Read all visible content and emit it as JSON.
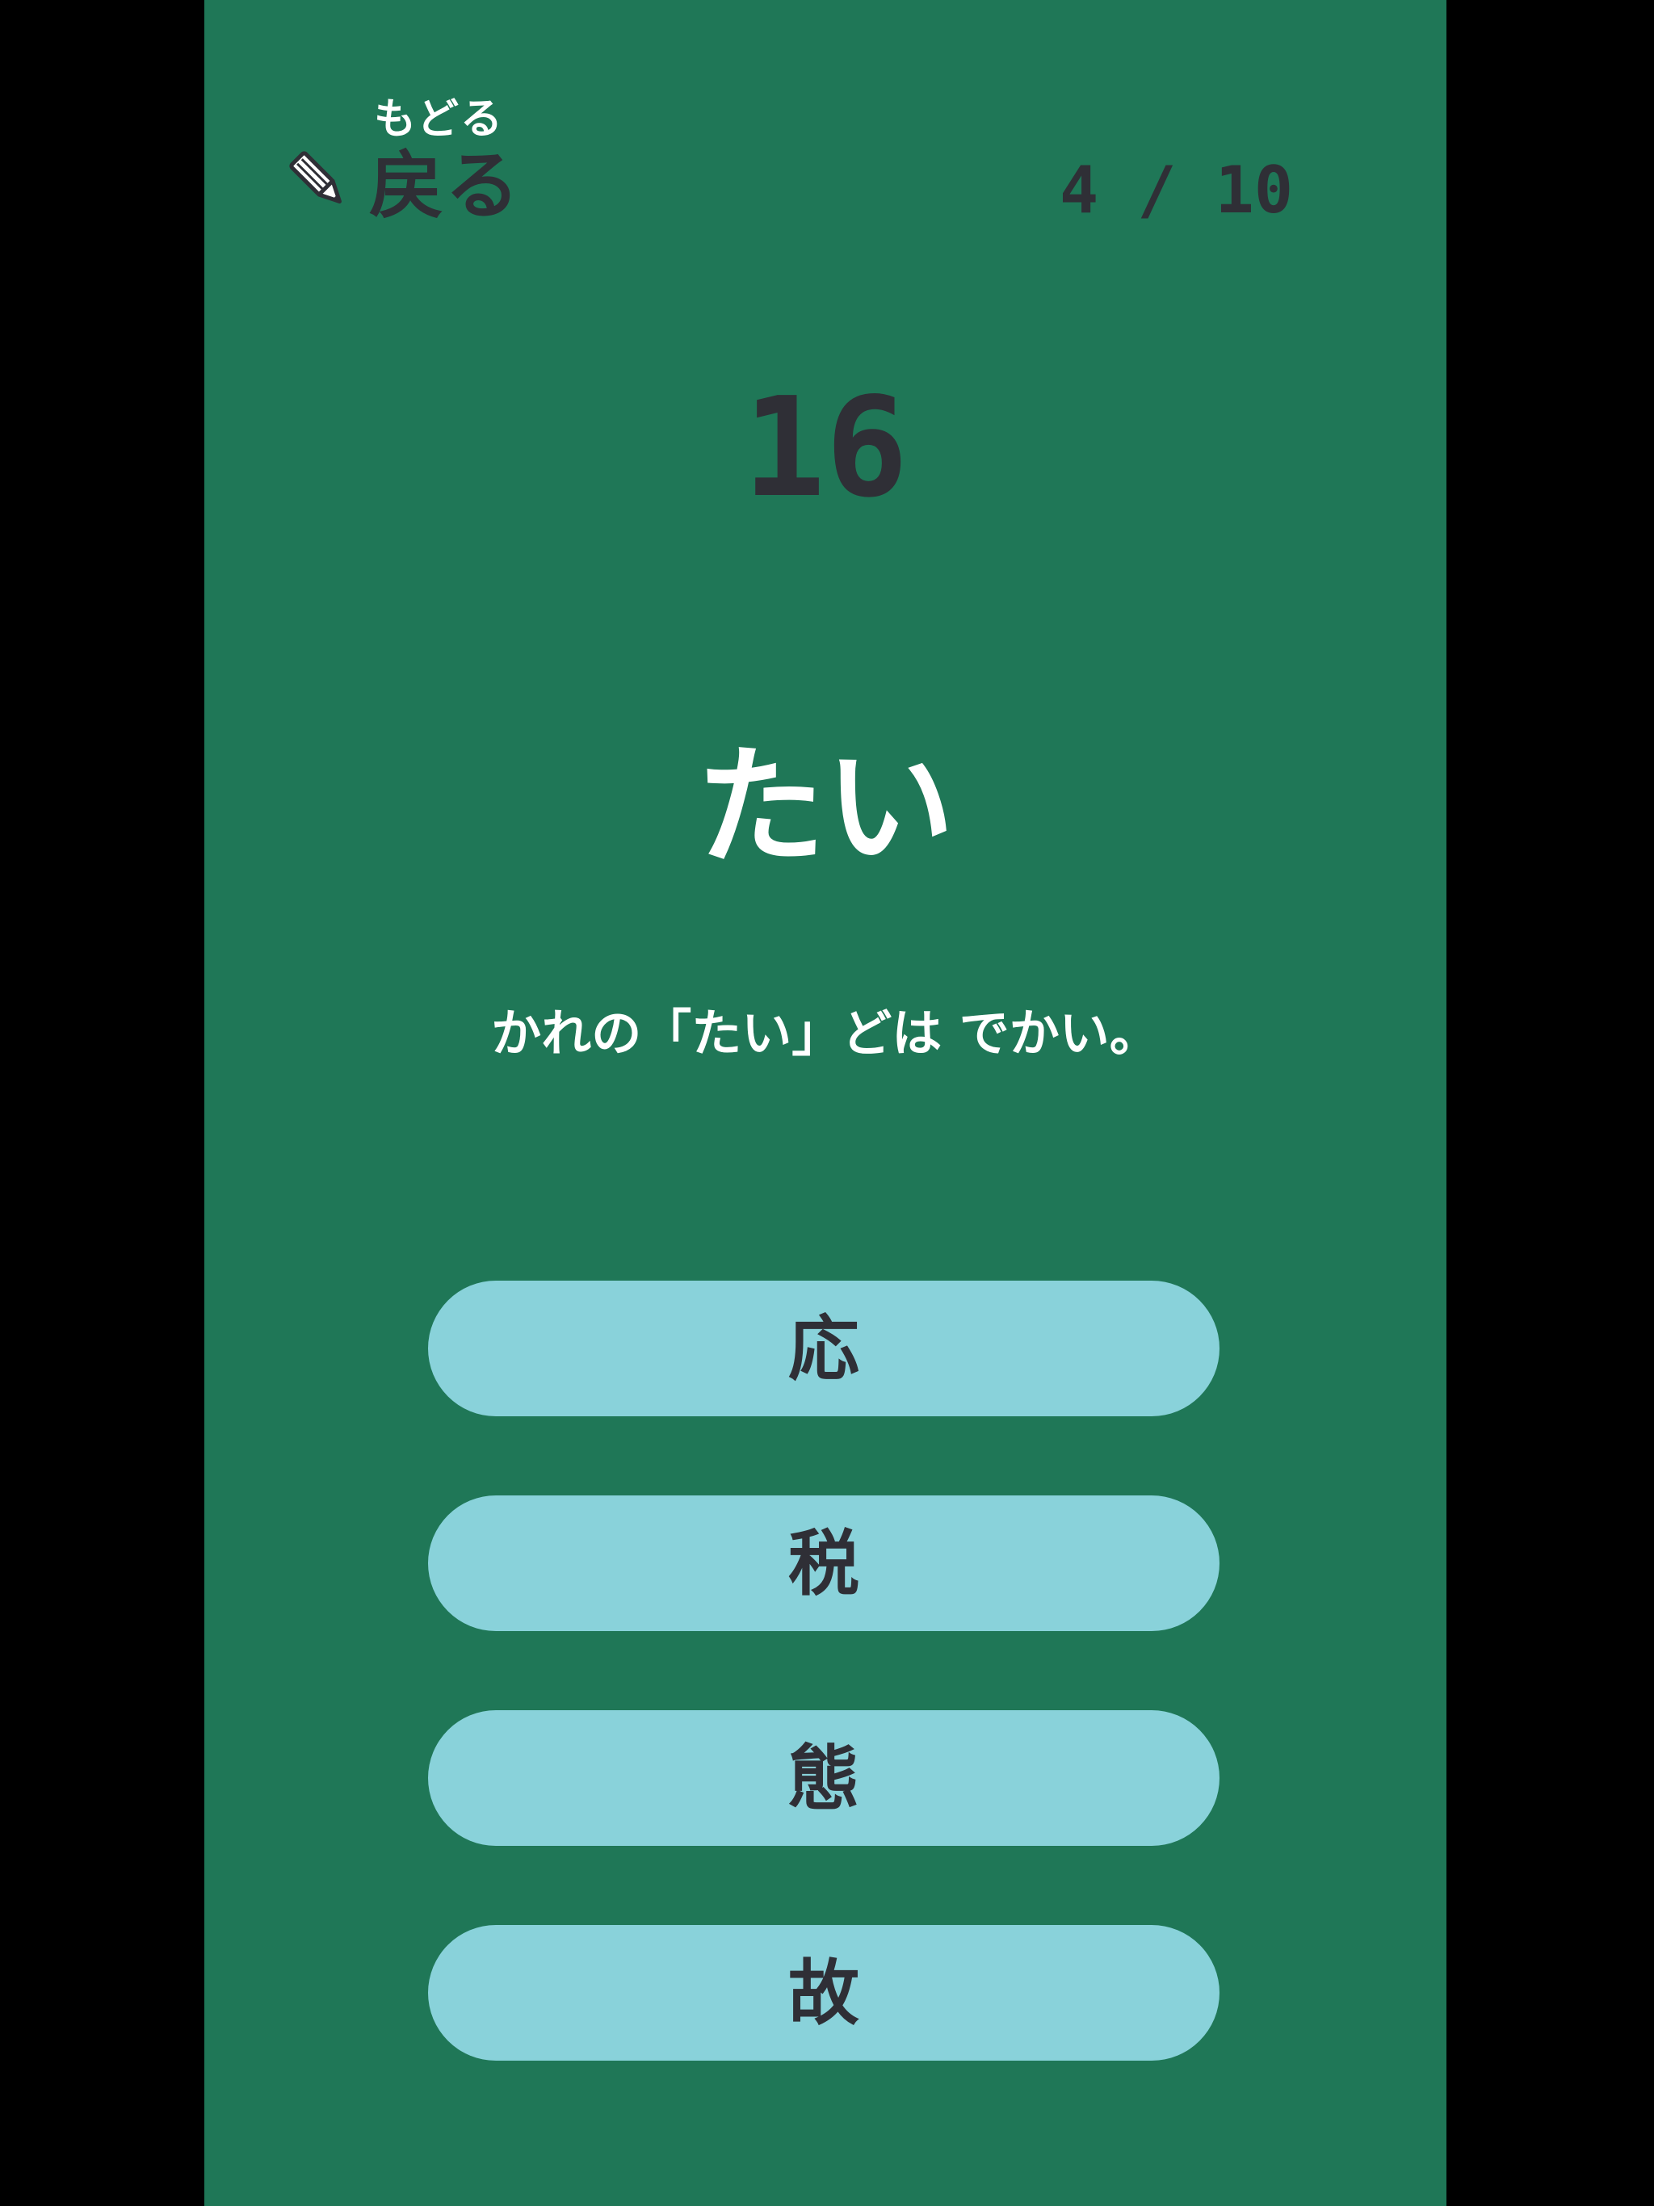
{
  "header": {
    "back_ruby": "もどる",
    "back_label": "戻る",
    "back_icon": "pencil-icon",
    "progress": "4 / 10"
  },
  "timer": {
    "value": "16"
  },
  "question": {
    "reading": "たい",
    "sentence": "かれの「たい」どは でかい。"
  },
  "choices": [
    {
      "label": "応"
    },
    {
      "label": "税"
    },
    {
      "label": "態"
    },
    {
      "label": "故"
    }
  ],
  "colors": {
    "background": "#1f7757",
    "letterbox": "#000000",
    "choice_fill": "#89d2da",
    "dark_text": "#2f2f36",
    "light_text": "#ffffff"
  }
}
